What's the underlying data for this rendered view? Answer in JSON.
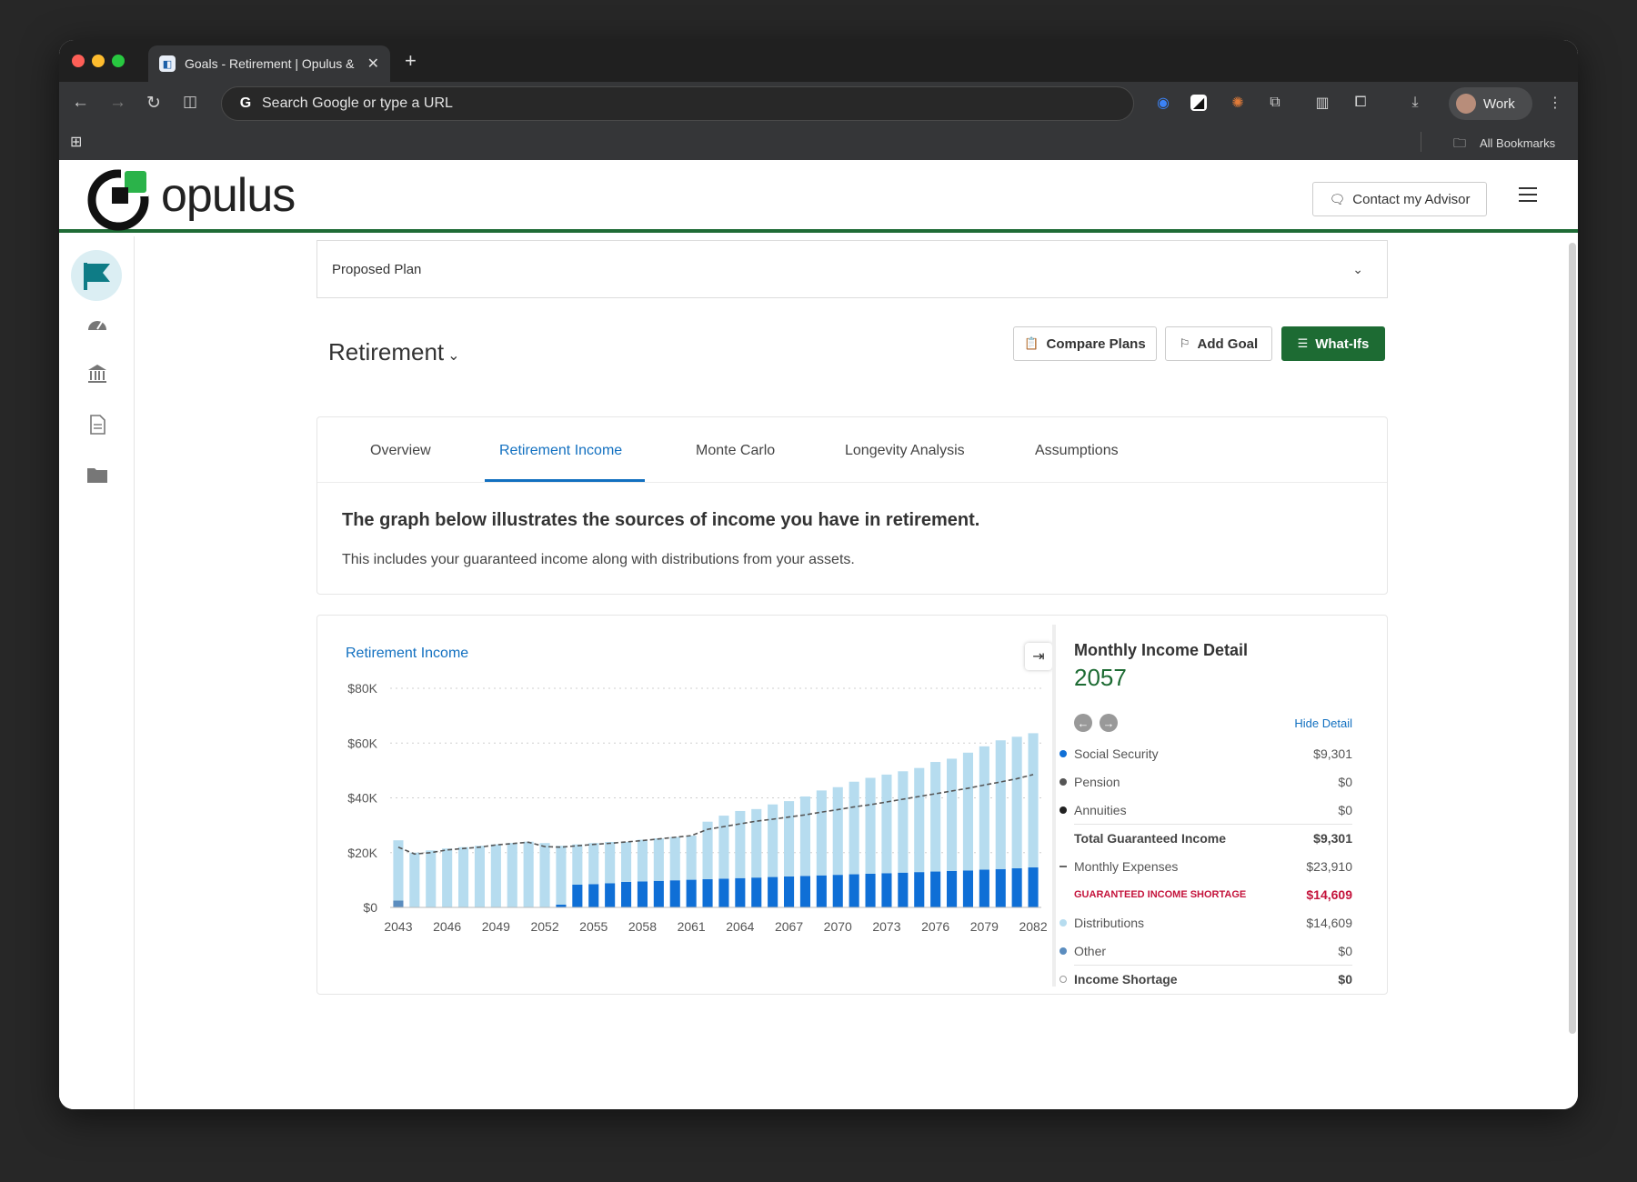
{
  "browser": {
    "tab_title": "Goals - Retirement | Opulus &",
    "new_tab": "+",
    "omnibox_placeholder": "Search Google or type a URL",
    "profile": "Work",
    "bookmarks": "All Bookmarks"
  },
  "header": {
    "logo_text": "opulus",
    "contact_label": "Contact my Advisor"
  },
  "sidebar": {
    "items": [
      {
        "icon": "flag-icon"
      },
      {
        "icon": "dashboard-icon"
      },
      {
        "icon": "bank-icon"
      },
      {
        "icon": "document-icon"
      },
      {
        "icon": "folder-icon"
      }
    ]
  },
  "plan": {
    "selected": "Proposed Plan"
  },
  "goal": {
    "title": "Retirement",
    "compare_label": "Compare Plans",
    "add_goal_label": "Add Goal",
    "whatifs_label": "What-Ifs"
  },
  "tabs": [
    {
      "label": "Overview"
    },
    {
      "label": "Retirement Income"
    },
    {
      "label": "Monte Carlo"
    },
    {
      "label": "Longevity Analysis"
    },
    {
      "label": "Assumptions"
    }
  ],
  "intro": {
    "heading": "The graph below illustrates the sources of income you have in retirement.",
    "text": "This includes your guaranteed income along with distributions from your assets."
  },
  "chart_title": "Retirement Income",
  "chart_data": {
    "type": "bar",
    "stacked": true,
    "title": "Retirement Income",
    "ylim": [
      0,
      80000
    ],
    "y_ticks": [
      "$0",
      "$20K",
      "$40K",
      "$60K",
      "$80K"
    ],
    "x_tick_labels": [
      "2043",
      "2046",
      "2049",
      "2052",
      "2055",
      "2058",
      "2061",
      "2064",
      "2067",
      "2070",
      "2073",
      "2076",
      "2079",
      "2082"
    ],
    "categories": [
      2043,
      2044,
      2045,
      2046,
      2047,
      2048,
      2049,
      2050,
      2051,
      2052,
      2053,
      2054,
      2055,
      2056,
      2057,
      2058,
      2059,
      2060,
      2061,
      2062,
      2063,
      2064,
      2065,
      2066,
      2067,
      2068,
      2069,
      2070,
      2071,
      2072,
      2073,
      2074,
      2075,
      2076,
      2077,
      2078,
      2079,
      2080,
      2081,
      2082
    ],
    "series": [
      {
        "name": "Social Security",
        "color": "#0f6fd6",
        "values": [
          0,
          0,
          0,
          0,
          0,
          0,
          0,
          0,
          0,
          0,
          1000,
          8300,
          8500,
          8800,
          9301,
          9500,
          9700,
          9900,
          10100,
          10300,
          10500,
          10700,
          10900,
          11100,
          11300,
          11500,
          11700,
          11900,
          12100,
          12300,
          12500,
          12700,
          12900,
          13100,
          13300,
          13500,
          13800,
          14000,
          14300,
          14600
        ]
      },
      {
        "name": "Distributions",
        "color": "#b6dcef",
        "values": [
          22000,
          20000,
          20800,
          21500,
          22000,
          22500,
          23000,
          23500,
          24000,
          23500,
          21500,
          14700,
          15000,
          15100,
          14609,
          15200,
          15500,
          15800,
          16100,
          21000,
          23000,
          24500,
          25000,
          26500,
          27500,
          29000,
          31000,
          32000,
          33800,
          35000,
          36000,
          37000,
          38000,
          40000,
          41000,
          43000,
          45000,
          47000,
          48000,
          49000
        ]
      },
      {
        "name": "Other",
        "color": "#5b8dbf",
        "values": [
          2500,
          0,
          0,
          0,
          0,
          0,
          0,
          0,
          0,
          0,
          0,
          0,
          0,
          0,
          0,
          0,
          0,
          0,
          0,
          0,
          0,
          0,
          0,
          0,
          0,
          0,
          0,
          0,
          0,
          0,
          0,
          0,
          0,
          0,
          0,
          0,
          0,
          0,
          0,
          0
        ]
      },
      {
        "name": "Monthly Expenses",
        "type": "line",
        "color": "#555555",
        "values": [
          22000,
          19500,
          20000,
          21000,
          21500,
          22000,
          22800,
          23300,
          23800,
          22200,
          22000,
          22500,
          23000,
          23400,
          23910,
          24400,
          25000,
          25600,
          26200,
          28500,
          29500,
          30500,
          31500,
          32200,
          33000,
          33800,
          34800,
          35700,
          36700,
          37500,
          38500,
          39500,
          40500,
          41500,
          42500,
          43500,
          44700,
          45800,
          47000,
          48500
        ]
      }
    ]
  },
  "detail": {
    "title": "Monthly Income Detail",
    "year": "2057",
    "hide_label": "Hide Detail",
    "prev_icon": "arrow-left-icon",
    "next_icon": "arrow-right-icon",
    "rows": [
      {
        "label": "Social Security",
        "value": "$9,301",
        "marker": "dot",
        "color": "#0f6fd6"
      },
      {
        "label": "Pension",
        "value": "$0",
        "marker": "dot",
        "color": "#555555"
      },
      {
        "label": "Annuities",
        "value": "$0",
        "marker": "dot",
        "color": "#222222"
      },
      {
        "label": "Total Guaranteed Income",
        "value": "$9,301",
        "style": "bold"
      },
      {
        "label": "Monthly Expenses",
        "value": "$23,910",
        "marker": "dash",
        "color": "#666666"
      },
      {
        "label": "GUARANTEED INCOME SHORTAGE",
        "value": "$14,609",
        "style": "red"
      },
      {
        "label": "Distributions",
        "value": "$14,609",
        "marker": "dot",
        "color": "#b6dcef"
      },
      {
        "label": "Other",
        "value": "$0",
        "marker": "dot",
        "color": "#5b8dbf"
      },
      {
        "label": "Income Shortage",
        "value": "$0",
        "style": "bold",
        "marker": "ring"
      }
    ]
  },
  "colors": {
    "brand_green": "#1d6b33",
    "link_blue": "#1270c0",
    "shortage_red": "#c4143c"
  }
}
